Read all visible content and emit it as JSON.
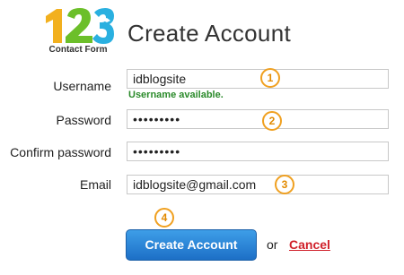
{
  "logo": {
    "digits": "123",
    "text": "Contact Form"
  },
  "page_title": "Create Account",
  "form": {
    "username": {
      "label": "Username",
      "value": "idblogsite",
      "hint": "Username available."
    },
    "password": {
      "label": "Password",
      "value": "•••••••••"
    },
    "confirm_password": {
      "label": "Confirm password",
      "value": "•••••••••"
    },
    "email": {
      "label": "Email",
      "value": "idblogsite@gmail.com"
    }
  },
  "badges": [
    "1",
    "2",
    "3",
    "4"
  ],
  "actions": {
    "create_label": "Create Account",
    "or_text": "or",
    "cancel_label": "Cancel"
  },
  "colors": {
    "button": "#1d6fc6",
    "badge": "#f0a020",
    "hint": "#2a8a2a",
    "cancel": "#d0202a"
  }
}
